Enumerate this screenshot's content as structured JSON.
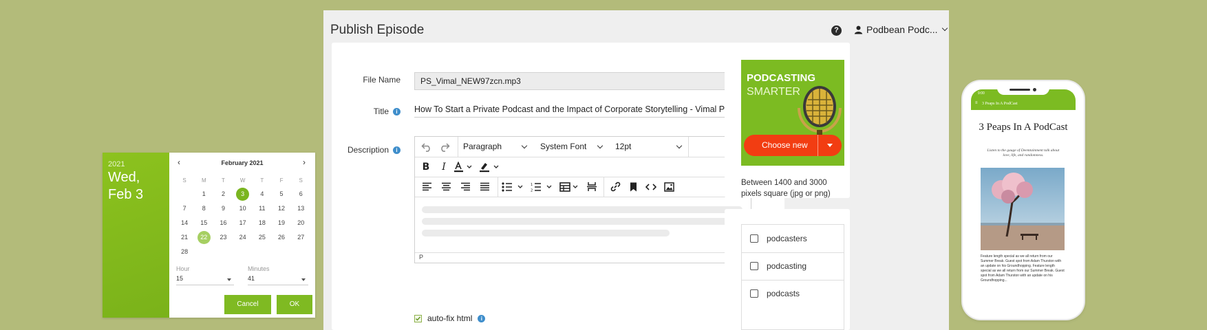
{
  "calendar": {
    "year": "2021",
    "date_line1": "Wed,",
    "date_line2": "Feb 3",
    "month": "February 2021",
    "weekdays": [
      "S",
      "M",
      "T",
      "W",
      "T",
      "F",
      "S"
    ],
    "rows": [
      [
        "",
        "1",
        "2",
        "3",
        "4",
        "5",
        "6"
      ],
      [
        "7",
        "8",
        "9",
        "10",
        "11",
        "12",
        "13"
      ],
      [
        "14",
        "15",
        "16",
        "17",
        "18",
        "19",
        "20"
      ],
      [
        "21",
        "22",
        "23",
        "24",
        "25",
        "26",
        "27"
      ],
      [
        "28",
        "",
        "",
        "",
        "",
        "",
        ""
      ]
    ],
    "selected": "3",
    "today": "22",
    "hour_label": "Hour",
    "hour_value": "15",
    "minutes_label": "Minutes",
    "minutes_value": "41",
    "cancel": "Cancel",
    "ok": "OK",
    "accent": "#7fba22"
  },
  "app": {
    "title": "Publish Episode",
    "help": "?",
    "user": "Podbean Podc...",
    "file_name_label": "File Name",
    "file_name": "PS_Vimal_NEW97zcn.mp3",
    "title_label": "Title",
    "title_value": "How To Start a Private Podcast and the Impact of Corporate Storytelling - Vimal Parker of",
    "description_label": "Description",
    "format": "Paragraph",
    "font": "System Font",
    "size": "12pt",
    "status_tag": "P",
    "autofix": "auto-fix html",
    "info": "i",
    "promo_line1": "PODCASTING",
    "promo_line2": "SMARTER",
    "choose_new": "Choose new",
    "image_hint": "Between 1400 and 3000 pixels square (jpg or png)",
    "tags": [
      "podcasters",
      "podcasting",
      "podcasts"
    ]
  },
  "phone": {
    "time": "9:00",
    "bar_title": "3 Peaps In A PodCast",
    "title": "3 Peaps In A PodCast",
    "tagline": "Listen to the gauge of Deemtainment talk about love, life, and randomness.",
    "body": "Feature length special as we all return from our Summer Break. Guest spot from Adam Thurston with an update on his Groundhopping. Feature length special as we all return from our Summer Break. Guest spot from Adam Thurston with an update on his Groundhopping..."
  }
}
